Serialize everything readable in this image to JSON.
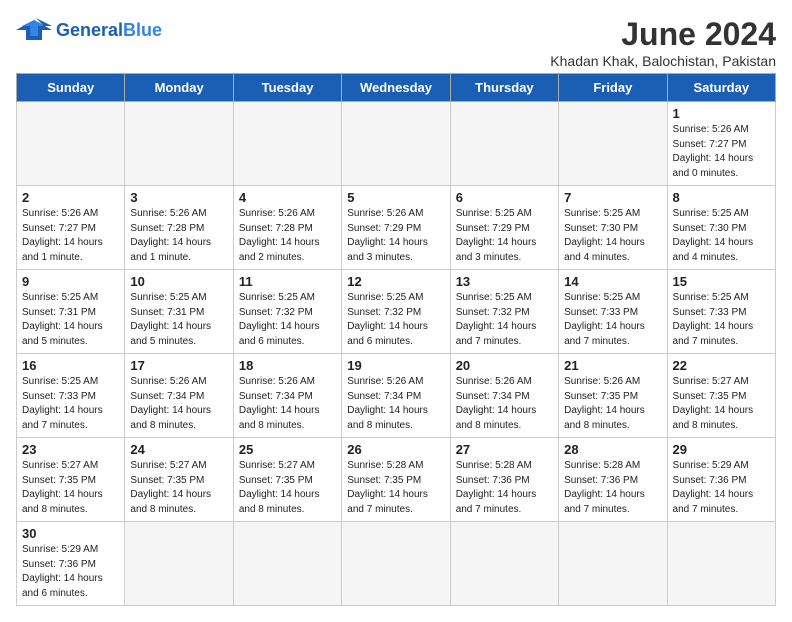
{
  "header": {
    "logo_general": "General",
    "logo_blue": "Blue",
    "month_title": "June 2024",
    "location": "Khadan Khak, Balochistan, Pakistan"
  },
  "weekdays": [
    "Sunday",
    "Monday",
    "Tuesday",
    "Wednesday",
    "Thursday",
    "Friday",
    "Saturday"
  ],
  "weeks": [
    [
      {
        "day": "",
        "info": ""
      },
      {
        "day": "",
        "info": ""
      },
      {
        "day": "",
        "info": ""
      },
      {
        "day": "",
        "info": ""
      },
      {
        "day": "",
        "info": ""
      },
      {
        "day": "",
        "info": ""
      },
      {
        "day": "1",
        "info": "Sunrise: 5:26 AM\nSunset: 7:27 PM\nDaylight: 14 hours\nand 0 minutes."
      }
    ],
    [
      {
        "day": "2",
        "info": "Sunrise: 5:26 AM\nSunset: 7:27 PM\nDaylight: 14 hours\nand 1 minute."
      },
      {
        "day": "3",
        "info": "Sunrise: 5:26 AM\nSunset: 7:28 PM\nDaylight: 14 hours\nand 1 minute."
      },
      {
        "day": "4",
        "info": "Sunrise: 5:26 AM\nSunset: 7:28 PM\nDaylight: 14 hours\nand 2 minutes."
      },
      {
        "day": "5",
        "info": "Sunrise: 5:26 AM\nSunset: 7:29 PM\nDaylight: 14 hours\nand 3 minutes."
      },
      {
        "day": "6",
        "info": "Sunrise: 5:25 AM\nSunset: 7:29 PM\nDaylight: 14 hours\nand 3 minutes."
      },
      {
        "day": "7",
        "info": "Sunrise: 5:25 AM\nSunset: 7:30 PM\nDaylight: 14 hours\nand 4 minutes."
      },
      {
        "day": "8",
        "info": "Sunrise: 5:25 AM\nSunset: 7:30 PM\nDaylight: 14 hours\nand 4 minutes."
      }
    ],
    [
      {
        "day": "9",
        "info": "Sunrise: 5:25 AM\nSunset: 7:31 PM\nDaylight: 14 hours\nand 5 minutes."
      },
      {
        "day": "10",
        "info": "Sunrise: 5:25 AM\nSunset: 7:31 PM\nDaylight: 14 hours\nand 5 minutes."
      },
      {
        "day": "11",
        "info": "Sunrise: 5:25 AM\nSunset: 7:32 PM\nDaylight: 14 hours\nand 6 minutes."
      },
      {
        "day": "12",
        "info": "Sunrise: 5:25 AM\nSunset: 7:32 PM\nDaylight: 14 hours\nand 6 minutes."
      },
      {
        "day": "13",
        "info": "Sunrise: 5:25 AM\nSunset: 7:32 PM\nDaylight: 14 hours\nand 7 minutes."
      },
      {
        "day": "14",
        "info": "Sunrise: 5:25 AM\nSunset: 7:33 PM\nDaylight: 14 hours\nand 7 minutes."
      },
      {
        "day": "15",
        "info": "Sunrise: 5:25 AM\nSunset: 7:33 PM\nDaylight: 14 hours\nand 7 minutes."
      }
    ],
    [
      {
        "day": "16",
        "info": "Sunrise: 5:25 AM\nSunset: 7:33 PM\nDaylight: 14 hours\nand 7 minutes."
      },
      {
        "day": "17",
        "info": "Sunrise: 5:26 AM\nSunset: 7:34 PM\nDaylight: 14 hours\nand 8 minutes."
      },
      {
        "day": "18",
        "info": "Sunrise: 5:26 AM\nSunset: 7:34 PM\nDaylight: 14 hours\nand 8 minutes."
      },
      {
        "day": "19",
        "info": "Sunrise: 5:26 AM\nSunset: 7:34 PM\nDaylight: 14 hours\nand 8 minutes."
      },
      {
        "day": "20",
        "info": "Sunrise: 5:26 AM\nSunset: 7:34 PM\nDaylight: 14 hours\nand 8 minutes."
      },
      {
        "day": "21",
        "info": "Sunrise: 5:26 AM\nSunset: 7:35 PM\nDaylight: 14 hours\nand 8 minutes."
      },
      {
        "day": "22",
        "info": "Sunrise: 5:27 AM\nSunset: 7:35 PM\nDaylight: 14 hours\nand 8 minutes."
      }
    ],
    [
      {
        "day": "23",
        "info": "Sunrise: 5:27 AM\nSunset: 7:35 PM\nDaylight: 14 hours\nand 8 minutes."
      },
      {
        "day": "24",
        "info": "Sunrise: 5:27 AM\nSunset: 7:35 PM\nDaylight: 14 hours\nand 8 minutes."
      },
      {
        "day": "25",
        "info": "Sunrise: 5:27 AM\nSunset: 7:35 PM\nDaylight: 14 hours\nand 8 minutes."
      },
      {
        "day": "26",
        "info": "Sunrise: 5:28 AM\nSunset: 7:35 PM\nDaylight: 14 hours\nand 7 minutes."
      },
      {
        "day": "27",
        "info": "Sunrise: 5:28 AM\nSunset: 7:36 PM\nDaylight: 14 hours\nand 7 minutes."
      },
      {
        "day": "28",
        "info": "Sunrise: 5:28 AM\nSunset: 7:36 PM\nDaylight: 14 hours\nand 7 minutes."
      },
      {
        "day": "29",
        "info": "Sunrise: 5:29 AM\nSunset: 7:36 PM\nDaylight: 14 hours\nand 7 minutes."
      }
    ],
    [
      {
        "day": "30",
        "info": "Sunrise: 5:29 AM\nSunset: 7:36 PM\nDaylight: 14 hours\nand 6 minutes."
      },
      {
        "day": "",
        "info": ""
      },
      {
        "day": "",
        "info": ""
      },
      {
        "day": "",
        "info": ""
      },
      {
        "day": "",
        "info": ""
      },
      {
        "day": "",
        "info": ""
      },
      {
        "day": "",
        "info": ""
      }
    ]
  ]
}
